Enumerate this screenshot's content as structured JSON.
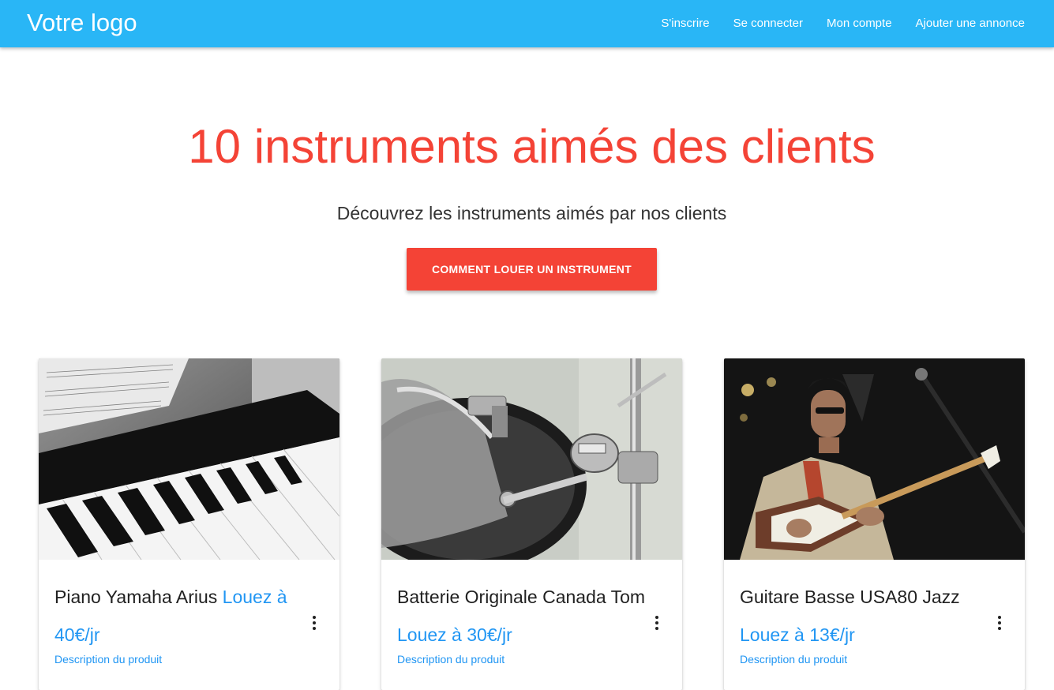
{
  "nav": {
    "logo": "Votre logo",
    "links": [
      "S'inscrire",
      "Se connecter",
      "Mon compte",
      "Ajouter une annonce"
    ]
  },
  "hero": {
    "title": "10 instruments aimés des clients",
    "subtitle": "Découvrez les instruments aimés par nos clients",
    "cta": "COMMENT LOUER UN INSTRUMENT"
  },
  "cards": [
    {
      "name": "Piano Yamaha Arius",
      "price": "Louez à 40€/jr",
      "link": "Description du produit",
      "menu_icon": "more-vert-icon"
    },
    {
      "name": "Batterie Originale Canada Tom",
      "price": "Louez à 30€/jr",
      "link": "Description du produit",
      "menu_icon": "more-vert-icon"
    },
    {
      "name": "Guitare Basse USA80 Jazz",
      "price": "Louez à 13€/jr",
      "link": "Description du produit",
      "menu_icon": "more-vert-icon"
    }
  ],
  "colors": {
    "nav": "#29b6f6",
    "accent": "#f44336",
    "price": "#2196f3"
  }
}
